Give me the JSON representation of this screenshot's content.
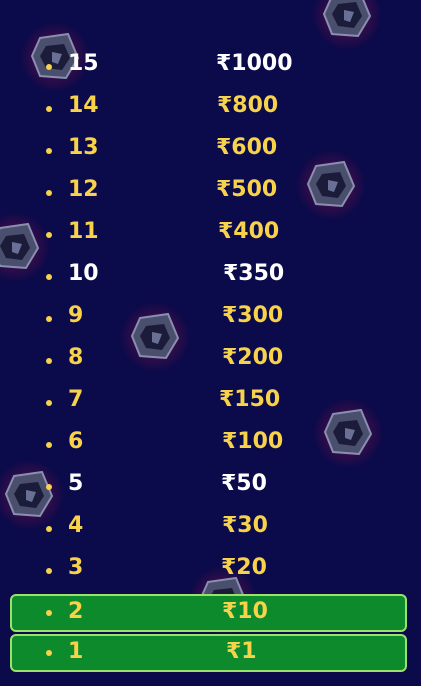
{
  "prize_ladder": [
    {
      "level": "15",
      "amount": "₹1000",
      "milestone": true,
      "won": false
    },
    {
      "level": "14",
      "amount": "₹800",
      "milestone": false,
      "won": false
    },
    {
      "level": "13",
      "amount": "₹600",
      "milestone": false,
      "won": false
    },
    {
      "level": "12",
      "amount": "₹500",
      "milestone": false,
      "won": false
    },
    {
      "level": "11",
      "amount": "₹400",
      "milestone": false,
      "won": false
    },
    {
      "level": "10",
      "amount": "₹350",
      "milestone": true,
      "won": false
    },
    {
      "level": "9",
      "amount": "₹300",
      "milestone": false,
      "won": false
    },
    {
      "level": "8",
      "amount": "₹200",
      "milestone": false,
      "won": false
    },
    {
      "level": "7",
      "amount": "₹150",
      "milestone": false,
      "won": false
    },
    {
      "level": "6",
      "amount": "₹100",
      "milestone": false,
      "won": false
    },
    {
      "level": "5",
      "amount": "₹50",
      "milestone": true,
      "won": false
    },
    {
      "level": "4",
      "amount": "₹30",
      "milestone": false,
      "won": false
    },
    {
      "level": "3",
      "amount": "₹20",
      "milestone": false,
      "won": false
    },
    {
      "level": "2",
      "amount": "₹10",
      "milestone": false,
      "won": true
    },
    {
      "level": "1",
      "amount": "₹1",
      "milestone": false,
      "won": true
    }
  ],
  "colors": {
    "background": "#0b0a4a",
    "amount_text": "#f7d24a",
    "milestone_text": "#ffffff",
    "won_fill": "#0d8a2c",
    "won_border": "#9ae26b"
  },
  "icons": {
    "background_decoration": "game-logo-icon"
  }
}
